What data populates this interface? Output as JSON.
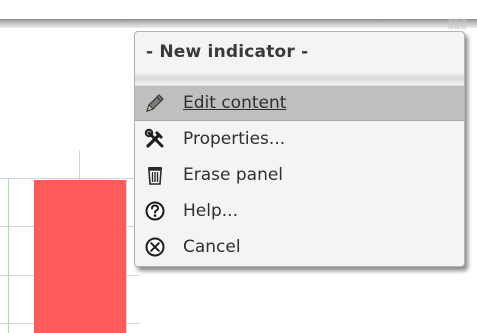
{
  "top_bar": {
    "grip_text": "▒▒▒"
  },
  "menu": {
    "title": "- New indicator -",
    "highlighted_index": 0,
    "items": [
      {
        "label": "Edit content",
        "icon": "pencil-icon"
      },
      {
        "label": "Properties...",
        "icon": "tools-icon"
      },
      {
        "label": "Erase panel",
        "icon": "trash-icon"
      },
      {
        "label": "Help...",
        "icon": "help-icon"
      },
      {
        "label": "Cancel",
        "icon": "cancel-icon"
      }
    ]
  },
  "colors": {
    "bar": "#ff5b5b",
    "axis": "#a6e2a6",
    "menu_background": "#f4f4f4",
    "menu_highlight": "#bfbfbf"
  }
}
